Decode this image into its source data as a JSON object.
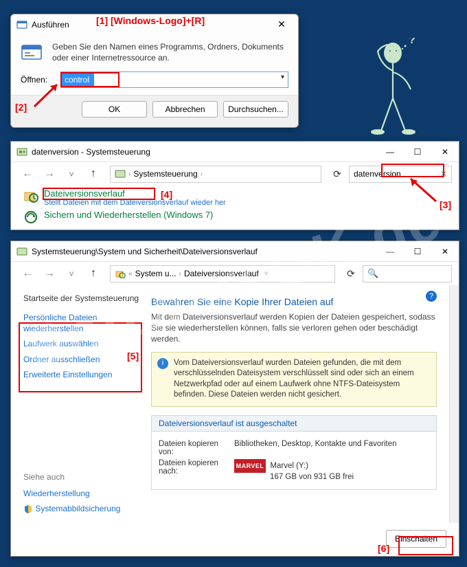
{
  "watermark": "SoftwareOK.de",
  "annotations": {
    "a1": "[1]  [Windows-Logo]+[R]",
    "a2": "[2]",
    "a3": "[3]",
    "a4": "[4]",
    "a5": "[5]",
    "a6": "[6]"
  },
  "run": {
    "title": "Ausführen",
    "desc": "Geben Sie den Namen eines Programms, Ordners, Dokuments oder einer Internetressource an.",
    "open_label": "Öffnen:",
    "input_value": "control",
    "ok": "OK",
    "cancel": "Abbrechen",
    "browse": "Durchsuchen..."
  },
  "cp1": {
    "title": "datenversion - Systemsteuerung",
    "crumb_root": "Systemsteuerung",
    "search_value": "datenversion",
    "result1_title": "Dateiversionsverlauf",
    "result1_sub": "Stellt Dateien mit dem Dateiversionsverlauf wieder her",
    "result2_title": "Sichern und Wiederherstellen (Windows 7)"
  },
  "cp2": {
    "title": "Systemsteuerung\\System und Sicherheit\\Dateiversionsverlauf",
    "crumb1": "System u...",
    "crumb2": "Dateiversionsverlauf",
    "side_head": "Startseite der Systemsteuerung",
    "side_links": {
      "l1": "Persönliche Dateien wiederherstellen",
      "l2": "Laufwerk auswählen",
      "l3": "Ordner ausschließen",
      "l4": "Erweiterte Einstellungen"
    },
    "siehe": "Siehe auch",
    "wieder": "Wiederherstellung",
    "sysabbild": "Systemabbildsicherung",
    "h1": "Bewahren Sie eine Kopie Ihrer Dateien auf",
    "p": "Mit dem Dateiversionsverlauf werden Kopien der Dateien gespeichert, sodass Sie sie wiederherstellen können, falls sie verloren gehen oder beschädigt werden.",
    "warn": "Vom Dateiversionsverlauf wurden Dateien gefunden, die mit dem verschlüsselnden Dateisystem verschlüsselt sind oder sich an einem Netzwerkpfad oder auf einem Laufwerk ohne NTFS-Dateisystem befinden. Diese Dateien werden nicht gesichert.",
    "status_head": "Dateiversionsverlauf ist ausgeschaltet",
    "copy_from_k": "Dateien kopieren von:",
    "copy_from_v": "Bibliotheken, Desktop, Kontakte und Favoriten",
    "copy_to_k": "Dateien kopieren nach:",
    "marvel_label": "MARVEL",
    "copy_to_v1": "Marvel (Y:)",
    "copy_to_v2": "167 GB von 931 GB frei",
    "enable": "Einschalten"
  }
}
